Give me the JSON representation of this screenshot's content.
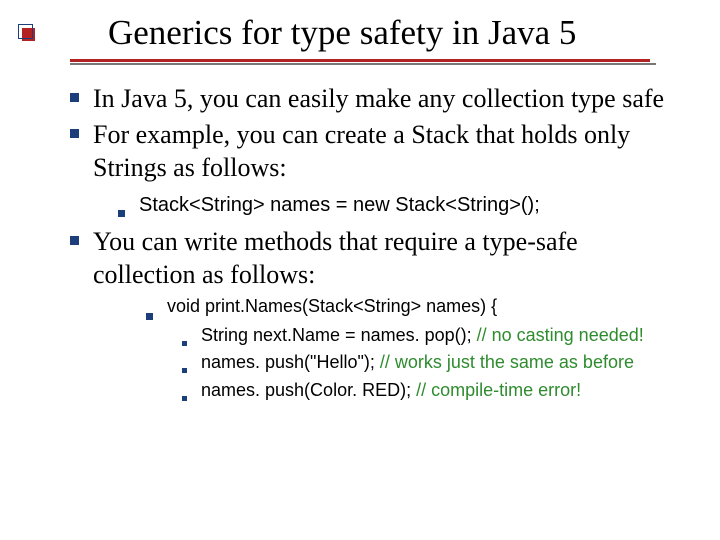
{
  "title": "Generics for type safety in Java 5",
  "bullets": {
    "b1": "In Java 5, you can easily make any collection type safe",
    "b2": "For example, you can create a Stack that holds only Strings as follows:",
    "b2_1": "Stack<String> names = new Stack<String>();",
    "b3": "You can write methods that require a type-safe collection as follows:",
    "b3_1": "void print.Names(Stack<String> names) {",
    "b3_1_1_code": "String next.Name = names. pop(); ",
    "b3_1_1_comment": "// no casting needed!",
    "b3_1_2_code": "names. push(\"Hello\"); ",
    "b3_1_2_comment": "// works just the same as before",
    "b3_1_3_code": "names. push(Color. RED); ",
    "b3_1_3_comment": "// compile-time error!"
  }
}
